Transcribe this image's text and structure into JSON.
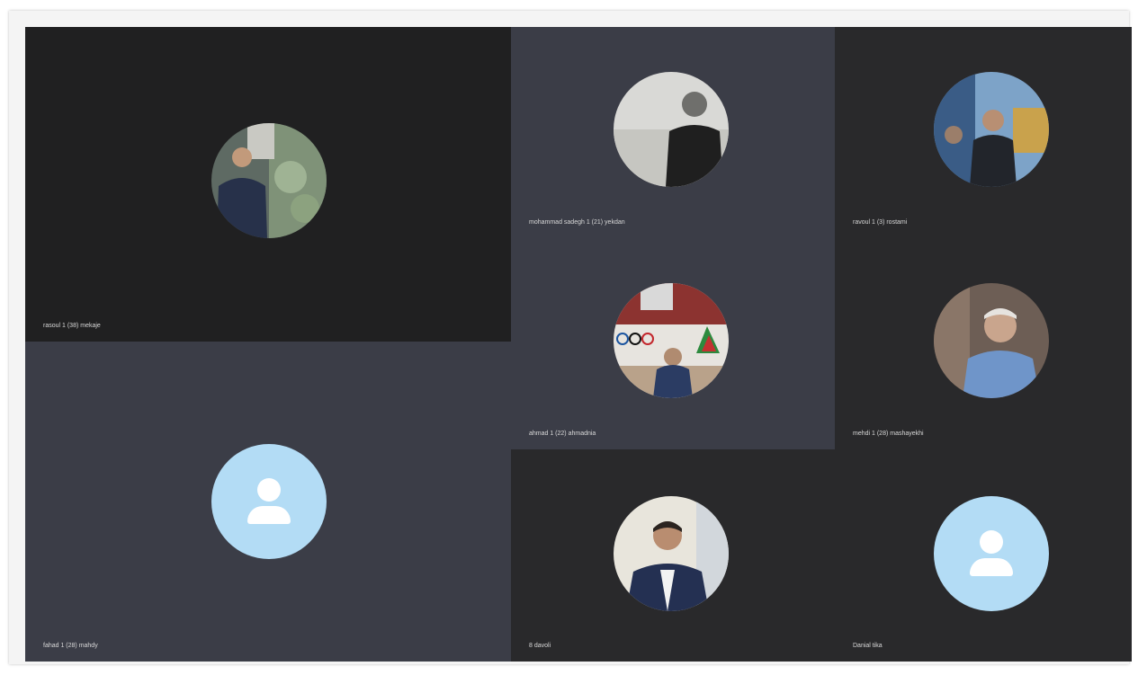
{
  "meeting": {
    "participants": [
      {
        "id": "p1",
        "name": "rasoul 1 (38) mekaje",
        "avatar": "photo-man-outdoor"
      },
      {
        "id": "p2",
        "name": "mohammad sadegh 1 (21) yekdan",
        "avatar": "photo-man-grayscale"
      },
      {
        "id": "p3",
        "name": "ravoul 1 (3) rostami",
        "avatar": "photo-man-office"
      },
      {
        "id": "p4",
        "name": "ahmad 1 (22) ahmadnia",
        "avatar": "photo-man-olympic-room"
      },
      {
        "id": "p5",
        "name": "mehdi 1 (28) mashayekhi",
        "avatar": "photo-older-man"
      },
      {
        "id": "p6",
        "name": "fahad 1 (28) mahdy",
        "avatar": "default-person-icon"
      },
      {
        "id": "p7",
        "name": "8 davoli",
        "avatar": "photo-man-suit"
      },
      {
        "id": "p8",
        "name": "Danial tika",
        "avatar": "default-person-icon"
      }
    ]
  },
  "colors": {
    "tile_dark": "#202021",
    "tile_slate": "#3b3d47",
    "default_avatar": "#b3dcf5"
  }
}
